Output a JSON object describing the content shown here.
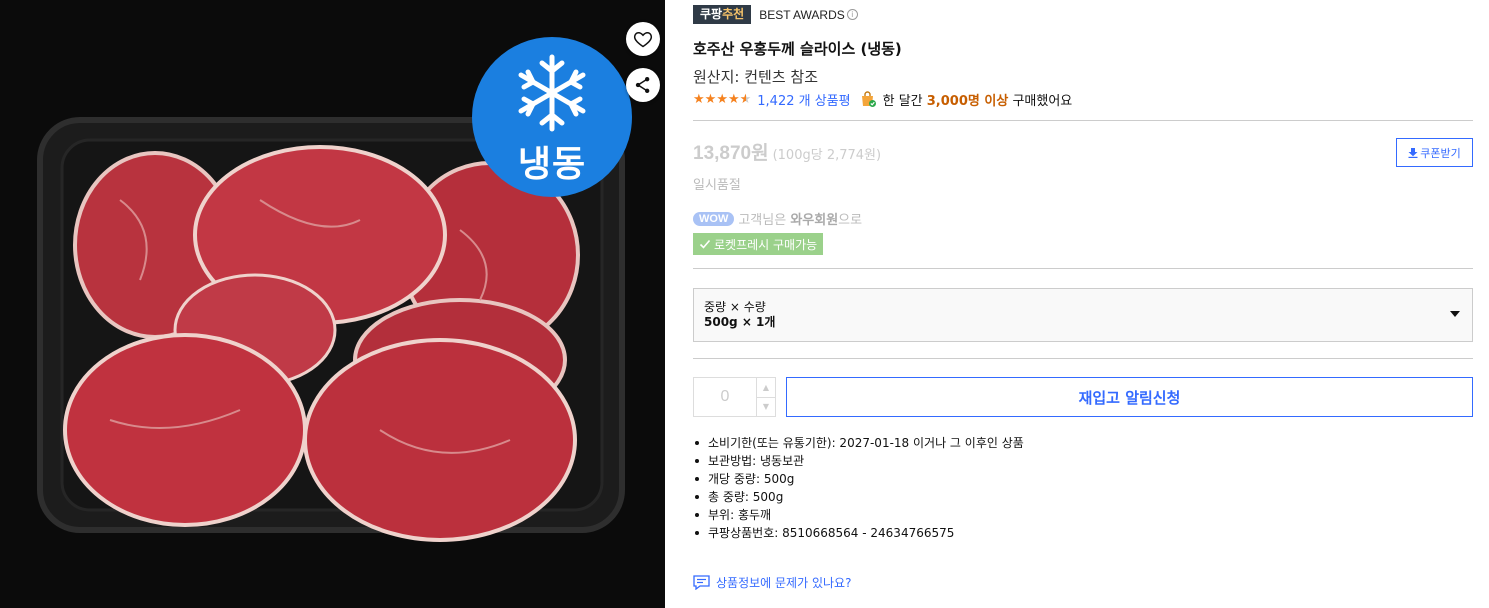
{
  "image": {
    "freeze_label": "냉동",
    "wishlist_icon": "heart-icon",
    "share_icon": "share-icon",
    "snowflake_icon": "snowflake-icon"
  },
  "badges": {
    "coupang_pick_part1": "쿠팡",
    "coupang_pick_part2": "추천",
    "best_awards": "BEST AWARDS",
    "info_glyph": "i"
  },
  "product": {
    "title": "호주산 우홍두께 슬라이스 (냉동)",
    "origin": "원산지: 컨텐츠 참조"
  },
  "rating": {
    "stars": 4.5,
    "review_count": "1,422 개 상품평",
    "monthly_prefix": "한 달간",
    "monthly_count": "3,000명 이상",
    "monthly_suffix": "구매했어요"
  },
  "pricing": {
    "price": "13,870원",
    "unit_price": "(100g당 2,774원)",
    "coupon_label": "쿠폰받기",
    "status": "일시품절"
  },
  "wow": {
    "pill": "WOW",
    "text_before": "고객님은",
    "text_bold": "와우회원",
    "text_after": "으로"
  },
  "rocket_fresh": {
    "label": "로켓프레시 구매가능"
  },
  "option": {
    "label": "중량 × 수량",
    "value": "500g × 1개"
  },
  "purchase": {
    "quantity": "0",
    "up": "▲",
    "down": "▼",
    "restock_label": "재입고 알림신청"
  },
  "details": [
    "소비기한(또는 유통기한): 2027-01-18 이거나 그 이후인 상품",
    "보관방법: 냉동보관",
    "개당 중량: 500g",
    "총 중량: 500g",
    "부위: 홍두깨",
    "쿠팡상품번호: 8510668564 - 24634766575"
  ],
  "report": {
    "label": "상품정보에 문제가 있나요?"
  },
  "colors": {
    "accent_blue": "#346aff",
    "freeze_blue": "#1b7fe0",
    "highlight_orange": "#c75e00",
    "fresh_green": "#9bd18b"
  }
}
